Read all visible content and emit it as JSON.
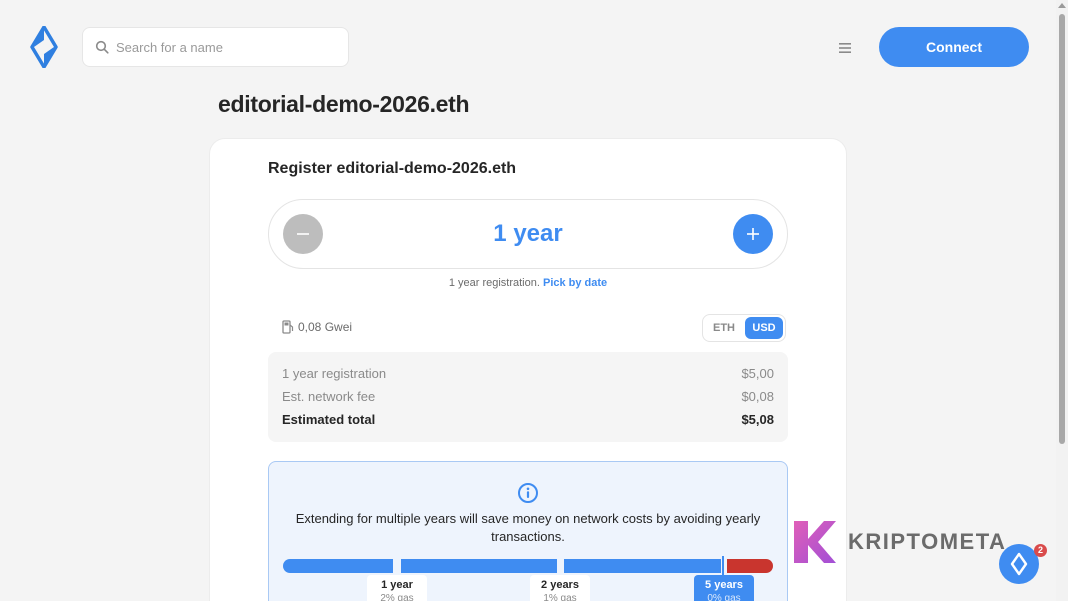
{
  "header": {
    "search_placeholder": "Search for a name",
    "connect_label": "Connect"
  },
  "page": {
    "title": "editorial-demo-2026.eth"
  },
  "register": {
    "title": "Register editorial-demo-2026.eth",
    "year_value": "1 year",
    "note_text": "1 year registration.",
    "pick_by_date": "Pick by date",
    "gas_value": "0,08 Gwei",
    "currency_eth": "ETH",
    "currency_usd": "USD",
    "selected_currency": "USD",
    "rows": [
      {
        "label": "1 year registration",
        "value": "$5,00"
      },
      {
        "label": "Est. network fee",
        "value": "$0,08"
      },
      {
        "label": "Estimated total",
        "value": "$5,08"
      }
    ]
  },
  "info": {
    "text": "Extending for multiple years will save money on network costs by avoiding yearly transactions.",
    "tips": [
      {
        "title": "1 year",
        "sub": "2% gas"
      },
      {
        "title": "2 years",
        "sub": "1% gas"
      },
      {
        "title": "5 years",
        "sub": "0% gas"
      }
    ]
  },
  "watermark": {
    "text": "KRIPTOMETA"
  },
  "chat": {
    "badge_count": "2"
  },
  "colors": {
    "accent": "#3f8cf1",
    "danger": "#c9352e",
    "background": "#f4f4f4"
  },
  "icons": {
    "logo": "ens-logo-icon",
    "search": "search-icon",
    "menu": "hamburger-menu-icon",
    "minus": "minus-icon",
    "plus": "plus-icon",
    "gas": "gas-pump-icon",
    "info": "info-icon",
    "chat": "ens-chat-icon"
  }
}
